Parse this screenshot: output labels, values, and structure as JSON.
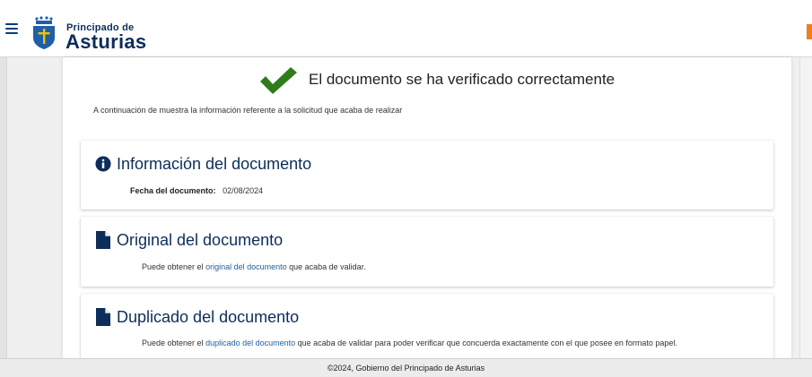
{
  "header": {
    "brand_small": "Principado de",
    "brand_big": "Asturias"
  },
  "main": {
    "verify_title": "El documento se ha verificado correctamente",
    "intro": "A continuación de muestra la información referente a la solicitud que acaba de realizar",
    "info": {
      "title": "Información del documento",
      "date_label": "Fecha del documento:",
      "date_value": "02/08/2024"
    },
    "original": {
      "title": "Original del documento",
      "text_before": "Puede obtener el ",
      "link": "original del documento",
      "text_after": " que acaba de validar."
    },
    "duplicate": {
      "title": "Duplicado del documento",
      "text_before": "Puede obtener el ",
      "link": "duplicado del documento",
      "text_after": " que acaba de validar para poder verificar que concuerda exactamente con el que posee en formato papel."
    }
  },
  "footer": {
    "text": "©2024, Gobierno del Principado de Asturias"
  },
  "colors": {
    "brand_navy": "#0d2d5a",
    "link_blue": "#1f5fa8",
    "success_green": "#2e7d1a",
    "accent_orange": "#f07e1b"
  },
  "icons": [
    "menu-icon",
    "asturias-crest-logo",
    "checkmark-icon",
    "info-icon",
    "document-icon"
  ]
}
